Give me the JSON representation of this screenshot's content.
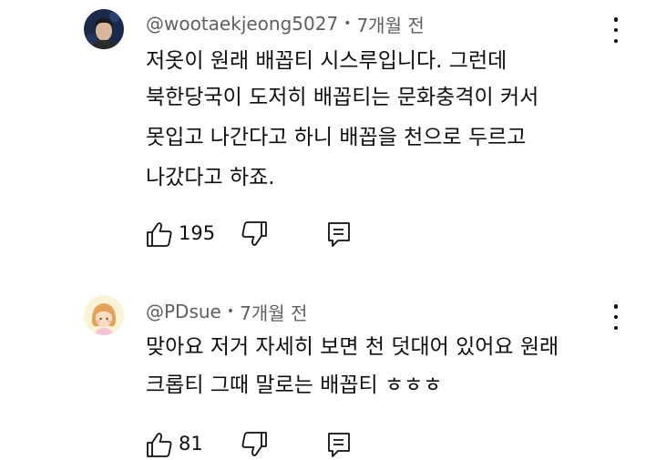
{
  "comments": [
    {
      "author": "@wootaekjeong5027",
      "separator": "•",
      "time": "7개월 전",
      "lines": [
        "저옷이 원래 배꼽티 시스루입니다. 그런데",
        "북한당국이 도저히 배꼽티는 문화충격이 커서",
        "못입고 나간다고 하니 배꼽을 천으로 두르고",
        "나갔다고 하죠."
      ],
      "likes": "195"
    },
    {
      "author": "@PDsue",
      "separator": "•",
      "time": "7개월 전",
      "lines": [
        "맞아요 저거 자세히 보면 천 덧대어 있어요 원래",
        "크롭티 그때 말로는 배꼽티 ㅎㅎㅎ"
      ],
      "likes": "81"
    }
  ]
}
